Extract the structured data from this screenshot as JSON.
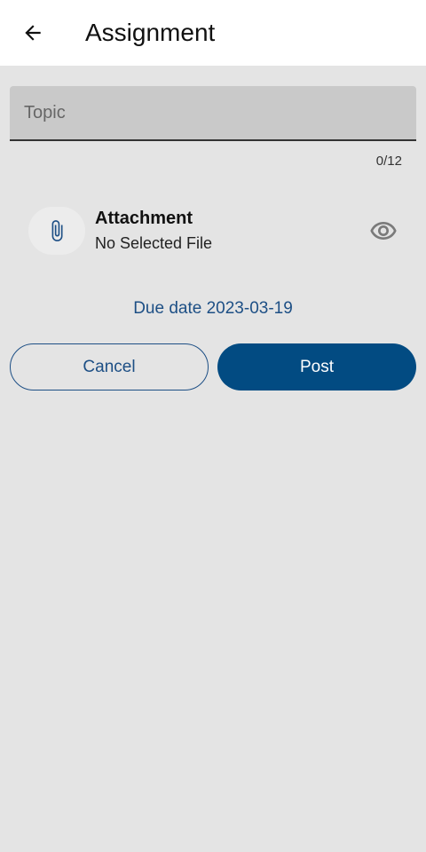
{
  "appbar": {
    "title": "Assignment",
    "back_icon": "arrow-left-icon"
  },
  "topic": {
    "placeholder": "Topic",
    "value": "",
    "counter": "0/12"
  },
  "attachment": {
    "title": "Attachment",
    "status": "No Selected File",
    "icon": "paperclip-icon",
    "preview_icon": "eye-icon"
  },
  "due_date": "Due date 2023-03-19",
  "actions": {
    "cancel_label": "Cancel",
    "post_label": "Post"
  },
  "colors": {
    "primary": "#024b82",
    "accent_text": "#1d4f85",
    "background": "#e4e4e4",
    "appbar": "#ffffff"
  }
}
